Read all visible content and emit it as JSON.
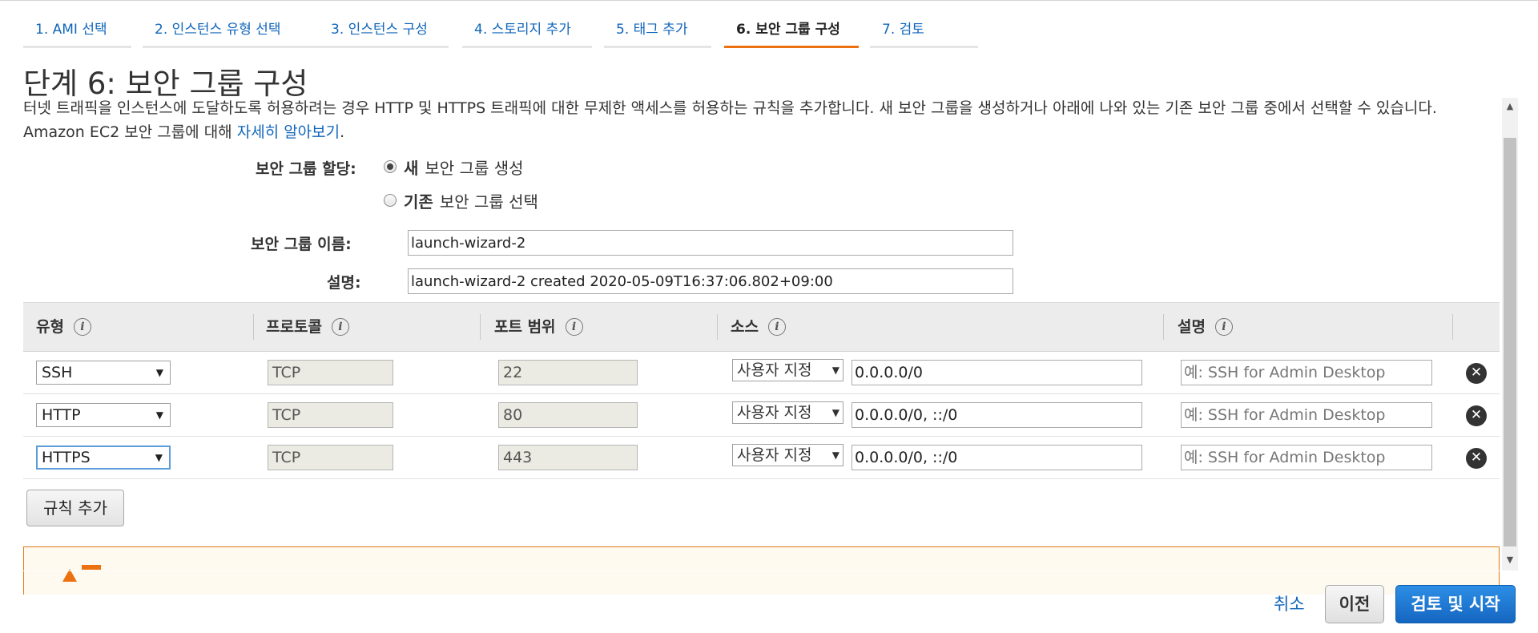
{
  "tabs": [
    {
      "label": "1. AMI 선택"
    },
    {
      "label": "2. 인스턴스 유형 선택"
    },
    {
      "label": "3. 인스턴스 구성"
    },
    {
      "label": "4. 스토리지 추가"
    },
    {
      "label": "5. 태그 추가"
    },
    {
      "label": "6. 보안 그룹 구성"
    },
    {
      "label": "7. 검토"
    }
  ],
  "page": {
    "title": "단계 6: 보안 그룹 구성",
    "description": "터넷 트래픽을 인스턴스에 도달하도록 허용하려는 경우 HTTP 및 HTTPS 트래픽에 대한 무제한 액세스를 허용하는 규칙을 추가합니다. 새 보안 그룹을 생성하거나 아래에 나와 있는 기존 보안 그룹 중에서 선택할 수 있습니다. Amazon EC2 보안 그룹에 대해 ",
    "learn_more": "자세히 알아보기",
    "period": "."
  },
  "form": {
    "assign_label": "보안 그룹 할당:",
    "option_new_bold": "새",
    "option_new_rest": "보안 그룹 생성",
    "option_existing_bold": "기존",
    "option_existing_rest": "보안 그룹 선택",
    "selected_option": "new",
    "name_label": "보안 그룹 이름:",
    "name_value": "launch-wizard-2",
    "desc_label": "설명:",
    "desc_value": "launch-wizard-2 created 2020-05-09T16:37:06.802+09:00"
  },
  "table": {
    "headers": {
      "type": "유형",
      "protocol": "프로토콜",
      "port_range": "포트 범위",
      "source": "소스",
      "description": "설명"
    },
    "rows": [
      {
        "type": "SSH",
        "protocol": "TCP",
        "port": "22",
        "source_type": "사용자 지정",
        "cidr": "0.0.0.0/0",
        "desc_placeholder": "예: SSH for Admin Desktop"
      },
      {
        "type": "HTTP",
        "protocol": "TCP",
        "port": "80",
        "source_type": "사용자 지정",
        "cidr": "0.0.0.0/0, ::/0",
        "desc_placeholder": "예: SSH for Admin Desktop"
      },
      {
        "type": "HTTPS",
        "protocol": "TCP",
        "port": "443",
        "source_type": "사용자 지정",
        "cidr": "0.0.0.0/0, ::/0",
        "desc_placeholder": "예: SSH for Admin Desktop"
      }
    ],
    "add_rule": "규칙 추가"
  },
  "icons": {
    "info": "info-icon",
    "delete": "close-circle-icon",
    "dropdown": "caret-down-icon",
    "warning": "warning-triangle-icon"
  },
  "footer": {
    "cancel": "취소",
    "previous": "이전",
    "review_launch": "검토 및 시작"
  },
  "colors": {
    "link": "#1166bb",
    "active_tab": "#ec7211",
    "primary_button": "#1f7ad4",
    "warning_border": "#e07b15"
  }
}
